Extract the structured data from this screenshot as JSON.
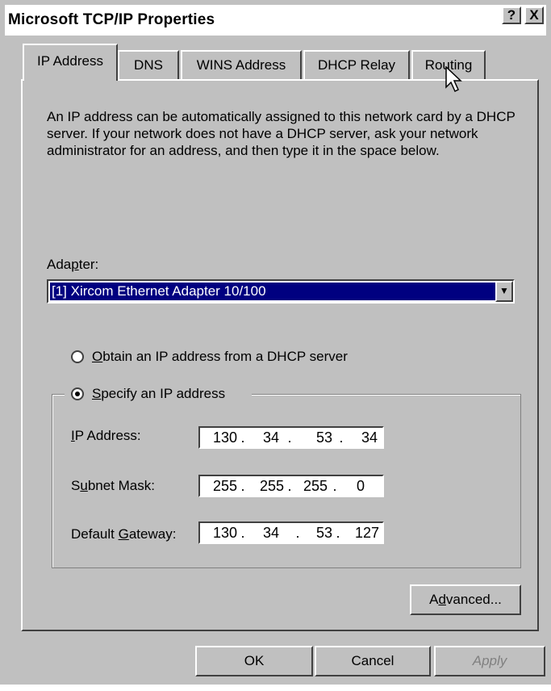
{
  "window": {
    "title": "Microsoft TCP/IP Properties",
    "help_label": "?",
    "close_label": "X"
  },
  "tabs": [
    {
      "label": "IP Address"
    },
    {
      "label": "DNS"
    },
    {
      "label": "WINS Address"
    },
    {
      "label": "DHCP Relay"
    },
    {
      "label": "Routing"
    }
  ],
  "description": "An IP address can be automatically assigned to this network card by a DHCP server.  If your network does not have a DHCP server, ask your network administrator for an address, and then type it in the space below.",
  "adapter": {
    "label": "Adapter:",
    "selected": "[1] Xircom Ethernet Adapter 10/100"
  },
  "radios": {
    "obtain": {
      "label": "Obtain an IP address from a DHCP server",
      "checked": false
    },
    "specify": {
      "label": "Specify an IP address",
      "checked": true
    }
  },
  "fields": {
    "ip": {
      "label": "IP Address:",
      "octets": [
        "130",
        "34",
        "53",
        "34"
      ]
    },
    "subnet": {
      "label": "Subnet Mask:",
      "octets": [
        "255",
        "255",
        "255",
        "0"
      ]
    },
    "gateway": {
      "label": "Default Gateway:",
      "octets": [
        "130",
        "34",
        "53",
        "127"
      ]
    }
  },
  "buttons": {
    "advanced": "Advanced...",
    "ok": "OK",
    "cancel": "Cancel",
    "apply": "Apply"
  },
  "colors": {
    "face": "#c0c0c0",
    "selection": "#000080",
    "shadow": "#404040",
    "highlight": "#ffffff"
  }
}
